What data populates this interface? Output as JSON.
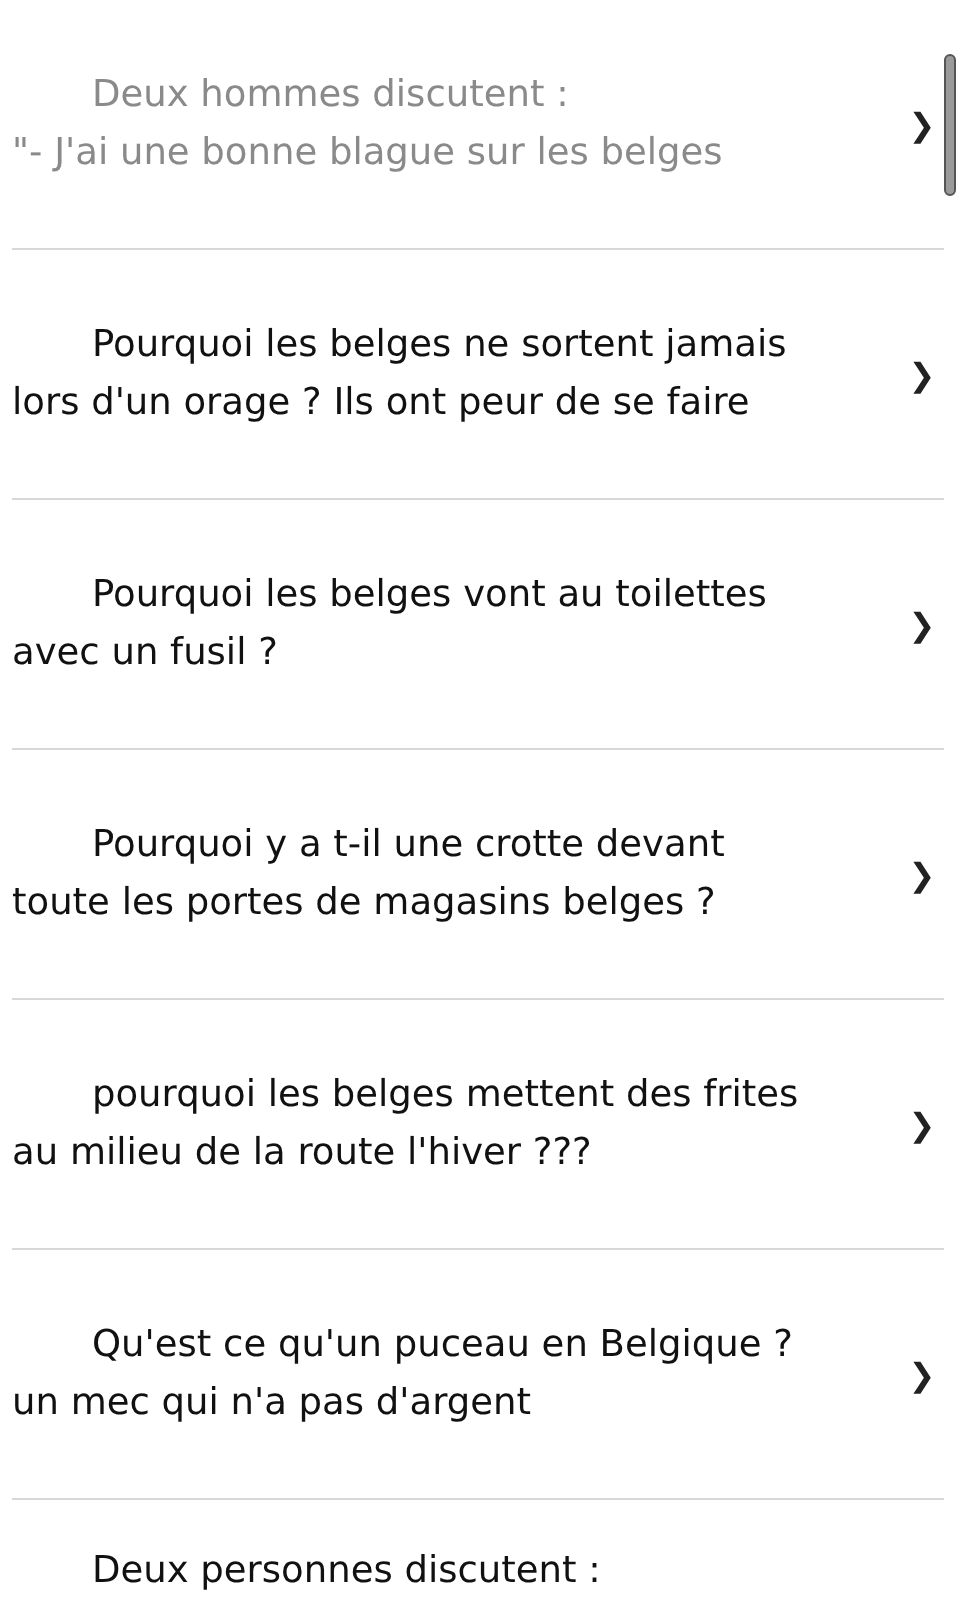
{
  "jokes": [
    {
      "text": "Deux hommes discutent :\n\"- J'ai une bonne blague sur les belges",
      "read": true,
      "chevron": "❯"
    },
    {
      "text": "Pourquoi les belges ne sortent jamais\nlors d'un orage ? Ils ont peur de se faire",
      "read": false,
      "chevron": "❯"
    },
    {
      "text": "Pourquoi les belges vont au toilettes\navec un fusil ?",
      "read": false,
      "chevron": "❯"
    },
    {
      "text": "Pourquoi y a t-il une crotte devant\ntoute les portes de magasins belges ?",
      "read": false,
      "chevron": "❯"
    },
    {
      "text": "pourquoi les belges mettent des frites\nau milieu de la route l'hiver ???",
      "read": false,
      "chevron": "❯"
    },
    {
      "text": "Qu'est ce qu'un puceau en Belgique ?\nun mec qui n'a pas d'argent",
      "read": false,
      "chevron": "❯"
    },
    {
      "text": "Deux personnes discutent :",
      "read": false
    }
  ]
}
